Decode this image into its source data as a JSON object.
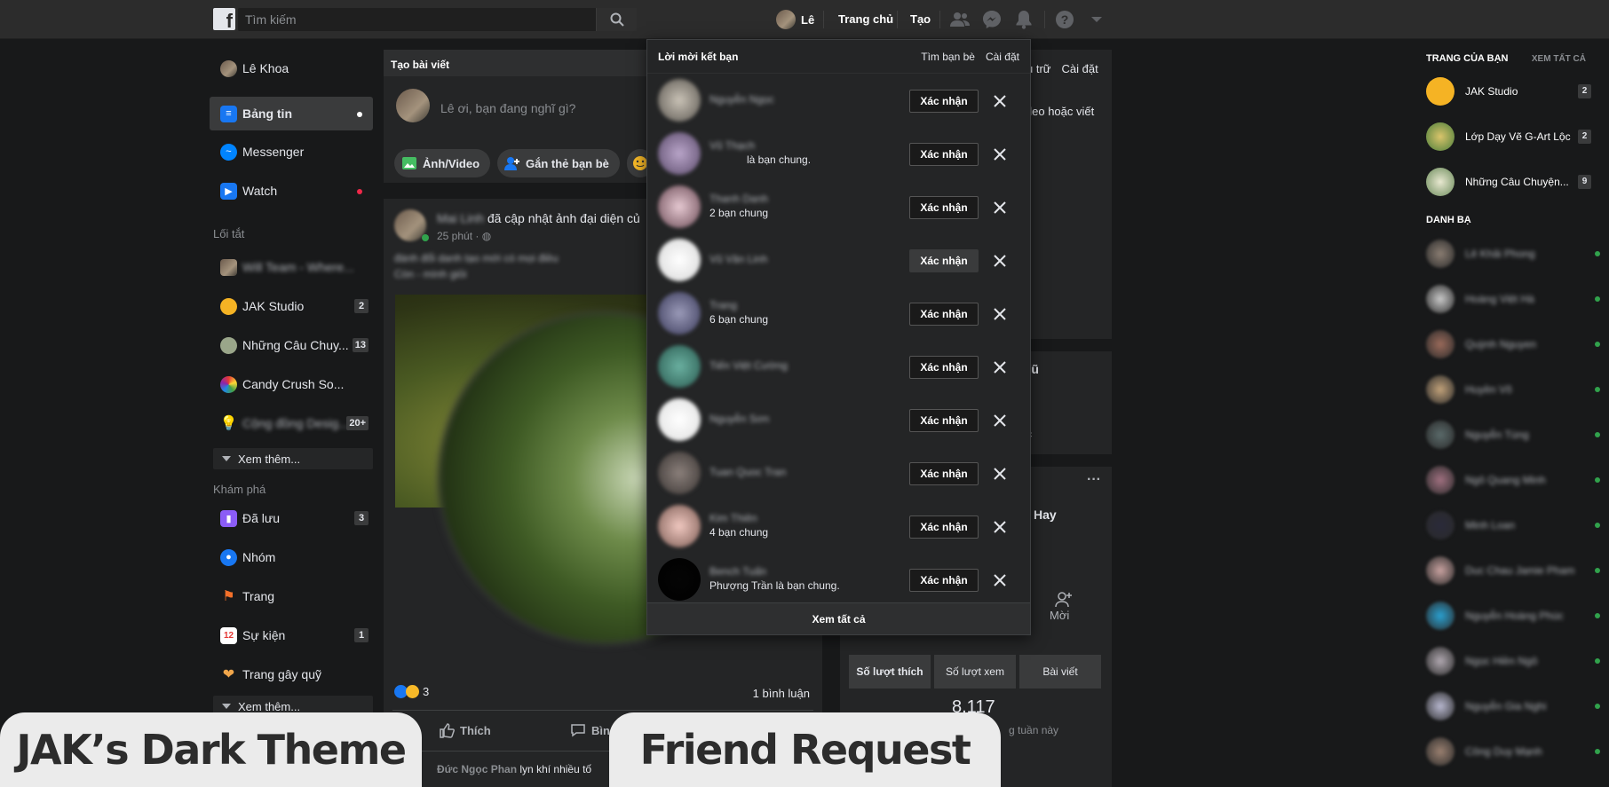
{
  "topbar": {
    "search_placeholder": "Tìm kiếm",
    "profile_name": "Lê",
    "nav_home": "Trang chủ",
    "nav_create": "Tạo"
  },
  "left_sidebar": {
    "user_name": "Lê Khoa",
    "news_feed": "Bảng tin",
    "messenger": "Messenger",
    "watch": "Watch",
    "shortcuts_header": "Lối tắt",
    "shortcuts": [
      {
        "label": "Will Team - Where...",
        "badge": ""
      },
      {
        "label": "JAK Studio",
        "badge": "2"
      },
      {
        "label": "Những Câu Chuy...",
        "badge": "13"
      },
      {
        "label": "Candy Crush So...",
        "badge": ""
      },
      {
        "label": "Cộng đồng Desig...",
        "badge": "20+"
      }
    ],
    "see_more": "Xem thêm...",
    "explore_header": "Khám phá",
    "explore": [
      {
        "label": "Đã lưu",
        "badge": "3"
      },
      {
        "label": "Nhóm",
        "badge": ""
      },
      {
        "label": "Trang",
        "badge": ""
      },
      {
        "label": "Sự kiện",
        "badge": "1"
      },
      {
        "label": "Trang gây quỹ",
        "badge": ""
      }
    ],
    "see_more_2": "Xem thêm..."
  },
  "composer": {
    "header": "Tạo bài viết",
    "prompt": "Lê ơi, bạn đang nghĩ gì?",
    "chip_photo": "Ảnh/Video",
    "chip_tag": "Gắn thẻ bạn bè"
  },
  "post": {
    "author": "Mai Linh",
    "action": "đã cập nhật ảnh đại diện củ",
    "time": "25 phút",
    "caption_line1": "đánh đổi danh tạo mới có mọi điều",
    "caption_line2": "Còn - mình giỏi",
    "reactions_count": "3",
    "comments_count": "1 bình luận",
    "like": "Thích",
    "comment": "Bìn",
    "commenter": "Đức Ngọc Phan",
    "comment_text": "lyn khí nhiều tố"
  },
  "mid_panel": {
    "top_links": [
      "u trữ",
      "Cài đặt"
    ],
    "video_text": "ideo hoặc viết",
    "name_fragment": "Vũ",
    "text_fragment": "rc",
    "hay": "Hay",
    "invite_label": "Mời",
    "stats_tabs": [
      "Số lượt thích",
      "Số lượt xem",
      "Bài viết"
    ],
    "stat_value": "8.117",
    "stat_note": "g tuần này"
  },
  "friend_requests": {
    "title": "Lời mời kết bạn",
    "find_friends": "Tìm bạn bè",
    "settings": "Cài đặt",
    "confirm_label": "Xác nhận",
    "see_all": "Xem tất cả",
    "rows": [
      {
        "name": "Nguyễn Ngọc",
        "sub": ""
      },
      {
        "name": "Vũ Thạch",
        "sub": "là bạn chung."
      },
      {
        "name": "Thanh Danh",
        "sub": "2 bạn chung"
      },
      {
        "name": "Vũ Văn Linh",
        "sub": ""
      },
      {
        "name": "Trang",
        "sub": "6 bạn chung"
      },
      {
        "name": "Tiến Việt Cường",
        "sub": ""
      },
      {
        "name": "Nguyễn Sơn",
        "sub": ""
      },
      {
        "name": "Tuan Quoc Tran",
        "sub": ""
      },
      {
        "name": "Kim Thiên",
        "sub": "4 bạn chung"
      },
      {
        "name": "Bench Tuấn",
        "sub": "Phượng Trần là bạn chung."
      }
    ]
  },
  "right_sidebar": {
    "pages_header": "TRANG CỦA BẠN",
    "see_all": "XEM TẤT CẢ",
    "pages": [
      {
        "name": "JAK Studio",
        "badge": "2"
      },
      {
        "name": "Lớp Dạy Vẽ G-Art Lộc",
        "badge": "2"
      },
      {
        "name": "Những Câu Chuyện...",
        "badge": "9"
      }
    ],
    "contacts_header": "DANH BẠ",
    "contacts": [
      "Lê Khải Phong",
      "Hoàng Việt Hà",
      "Quỳnh Nguyen",
      "Huyền Võ",
      "Nguyễn Tùng",
      "Ngô Quang Minh",
      "Minh Loan",
      "Duc Chau Jamie Pham",
      "Nguyễn Hoàng Phúc",
      "Ngọc Hiền Ngô",
      "Nguyễn Gia Nghi",
      "Công Duy Mạnh"
    ]
  },
  "banners": {
    "left": "JAK’s Dark Theme",
    "right": "Friend Request"
  },
  "colors": {
    "online": "#31a24c",
    "notification_dot": "#f02849",
    "background": "#18191a"
  }
}
